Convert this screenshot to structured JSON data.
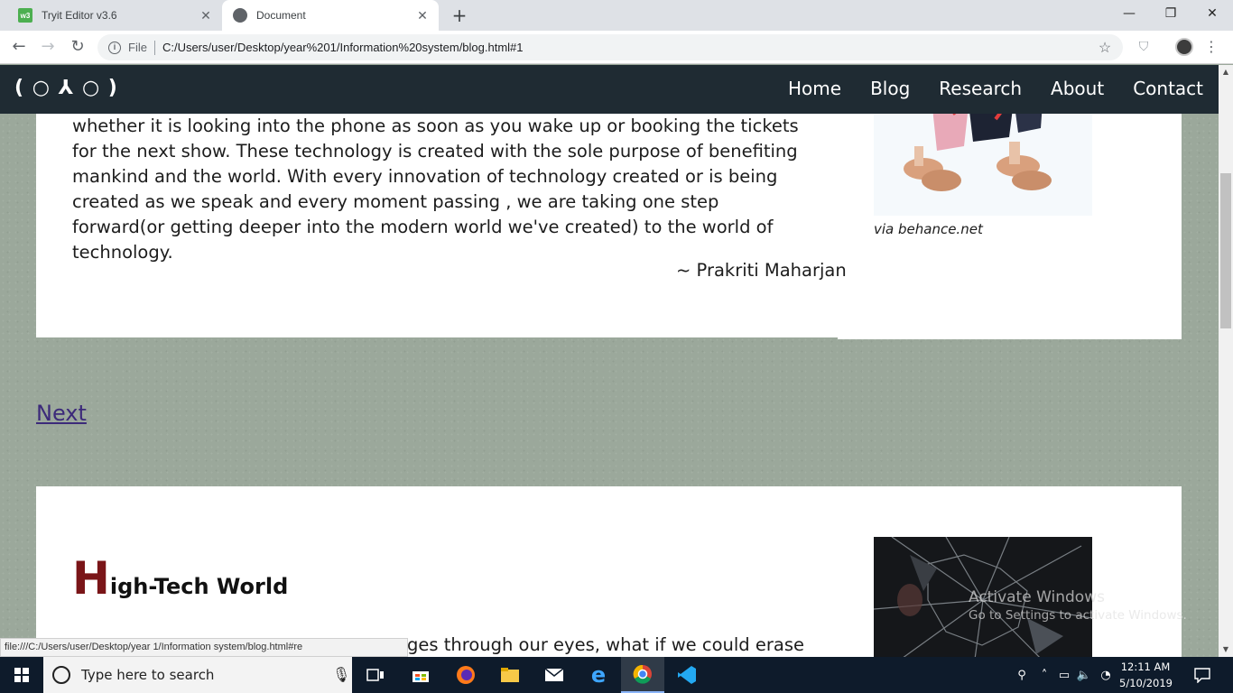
{
  "browser": {
    "tabs": [
      {
        "title": "Tryit Editor v3.6",
        "favicon": "w3schools-icon",
        "favicon_text": "w3"
      },
      {
        "title": "Document",
        "favicon": "globe-icon"
      }
    ],
    "address": {
      "scheme_label": "File",
      "url": "C:/Users/user/Desktop/year%201/Information%20system/blog.html#1"
    }
  },
  "site": {
    "logo": "( ○ ⅄ ○ )",
    "nav": [
      "Home",
      "Blog",
      "Research",
      "About",
      "Contact"
    ]
  },
  "article1": {
    "paragraph": "whether it is looking into the phone as soon as you wake up or booking the tickets for the next show. These technology is created with the sole purpose of benefiting mankind and the world. With every innovation of technology created or is being created as we speak and every moment passing , we are taking one step forward(or getting deeper into the modern world we've created) to the world of technology.",
    "author": "~ Prakriti Maharjan",
    "image_caption": "via behance.net"
  },
  "next_link": "Next",
  "article2": {
    "title_initial": "H",
    "title_rest": "igh-Tech World",
    "visible_text": "ges through our eyes, what if we could erase"
  },
  "watermark": {
    "title": "Activate Windows",
    "subtitle": "Go to Settings to activate Windows."
  },
  "status_bar_url": "file:///C:/Users/user/Desktop/year 1/Information system/blog.html#re",
  "taskbar": {
    "search_placeholder": "Type here to search",
    "time": "12:11 AM",
    "date": "5/10/2019"
  },
  "colors": {
    "nav_bg": "#1f2b33",
    "page_bg": "#9ba89b",
    "dropcap": "#7a1518",
    "link": "#3c2a7a",
    "taskbar": "#0e1b2b"
  }
}
